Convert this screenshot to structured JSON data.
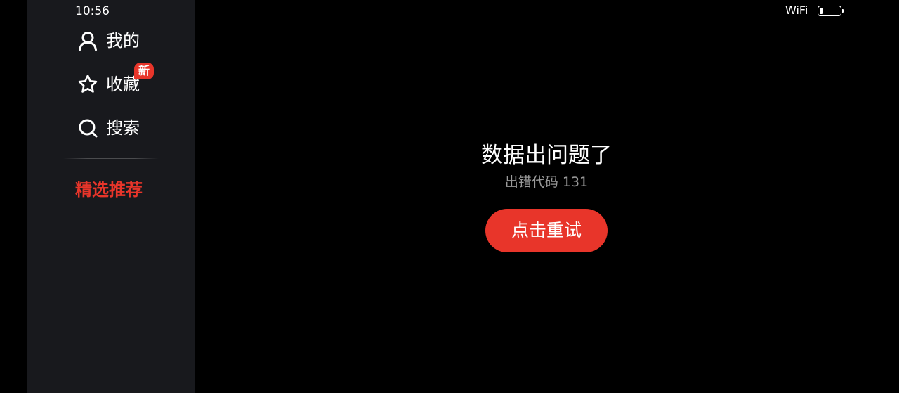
{
  "status_bar": {
    "time": "10:56",
    "network_label": "WiFi",
    "battery_level": 0.18
  },
  "sidebar": {
    "items": [
      {
        "label": "我的",
        "icon": "person-icon"
      },
      {
        "label": "收藏",
        "icon": "star-icon",
        "badge": "新"
      },
      {
        "label": "搜索",
        "icon": "search-icon"
      }
    ],
    "featured_label": "精选推荐"
  },
  "main": {
    "error_title": "数据出问题了",
    "error_code": "出错代码 131",
    "retry_label": "点击重试"
  },
  "colors": {
    "background": "#000000",
    "sidebar_background": "#18191d",
    "accent": "#e8352a",
    "text_primary": "#ffffff",
    "text_secondary": "#9a9a9a"
  }
}
